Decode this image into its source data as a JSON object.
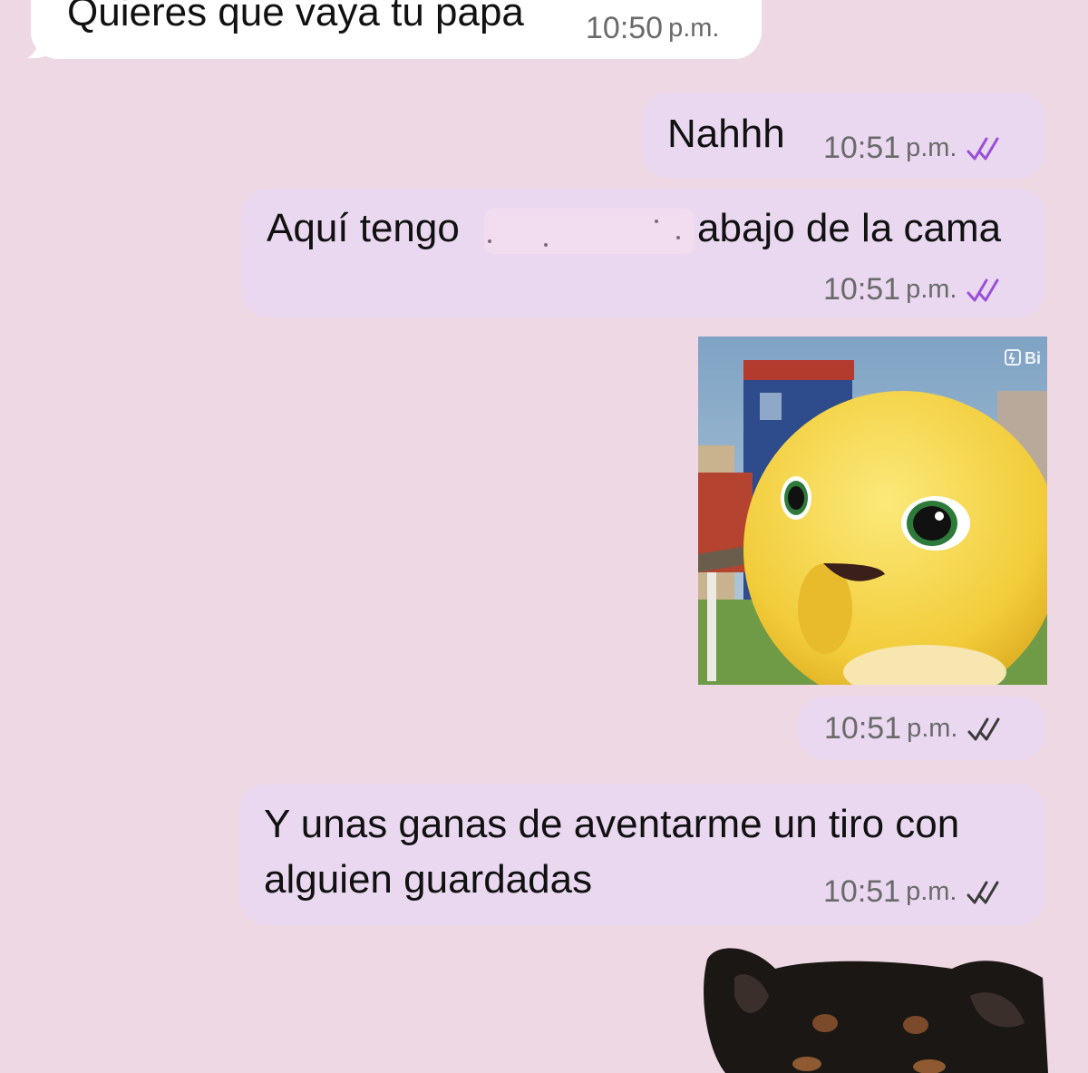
{
  "messages": [
    {
      "text": "Quieres que vaya tu papa",
      "time": "10:50",
      "suffix": "p.m."
    },
    {
      "text": "Nahhh",
      "time": "10:51",
      "suffix": "p.m."
    },
    {
      "text_before": "Aquí tengo",
      "text_after": "abajo de la cama",
      "time": "10:51",
      "suffix": "p.m."
    },
    {
      "time": "10:51",
      "suffix": "p.m."
    },
    {
      "line1": "Y unas ganas de aventarme un tiro con",
      "line2": "alguien guardadas",
      "time": "10:51",
      "suffix": "p.m."
    }
  ],
  "watermark": "Bi",
  "colors": {
    "background": "#eed8e4",
    "incoming_bubble": "#ffffff",
    "outgoing_bubble": "#ead8f1",
    "read_check": "#9a4fd6",
    "delivered_check": "#3a3a3a"
  },
  "icons": [
    "double-check-icon",
    "sticker-character",
    "sticker-dog"
  ]
}
